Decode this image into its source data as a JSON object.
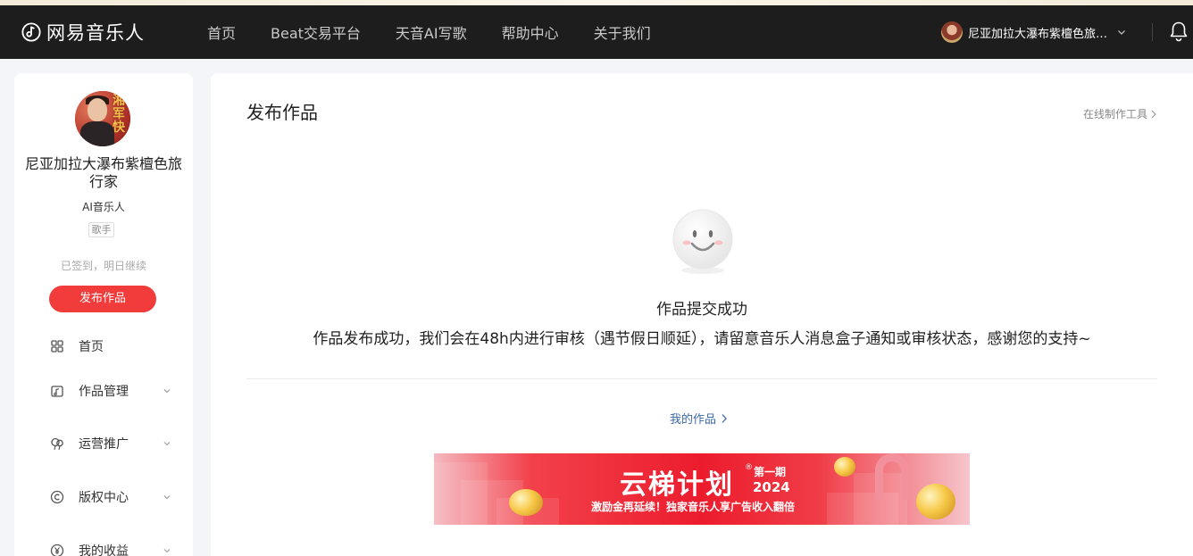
{
  "header": {
    "logo_text": "网易音乐人",
    "nav": [
      "首页",
      "Beat交易平台",
      "天音AI写歌",
      "帮助中心",
      "关于我们"
    ],
    "user_name": "尼亚加拉大瀑布紫檀色旅行家"
  },
  "sidebar": {
    "avatar_text": "湘军快",
    "profile_name": "尼亚加拉大瀑布紫檀色旅行家",
    "role": "AI音乐人",
    "tag": "歌手",
    "checkin_text": "已签到，明日继续",
    "publish_button": "发布作品",
    "menu": [
      {
        "label": "首页",
        "icon": "grid-icon",
        "expandable": false
      },
      {
        "label": "作品管理",
        "icon": "music-folder-icon",
        "expandable": true
      },
      {
        "label": "运营推广",
        "icon": "balloon-icon",
        "expandable": true
      },
      {
        "label": "版权中心",
        "icon": "copyright-icon",
        "expandable": true
      },
      {
        "label": "我的收益",
        "icon": "yuan-icon",
        "expandable": true
      }
    ]
  },
  "main": {
    "title": "发布作品",
    "online_tool_link": "在线制作工具",
    "success_title": "作品提交成功",
    "success_desc": "作品发布成功，我们会在48h内进行审核（遇节假日顺延），请留意音乐人消息盒子通知或审核状态，感谢您的支持~",
    "my_works_link": "我的作品"
  },
  "banner": {
    "title": "云梯计划",
    "reg_mark": "®",
    "issue": "第一期",
    "year": "2024",
    "subtitle": "激励金再延续！独家音乐人享广告收入翻倍"
  },
  "colors": {
    "topbar_bg": "#1d1d1d",
    "accent_red": "#f23b3b",
    "link_blue": "#3b6aa8",
    "page_bg": "#f4f5f9"
  }
}
